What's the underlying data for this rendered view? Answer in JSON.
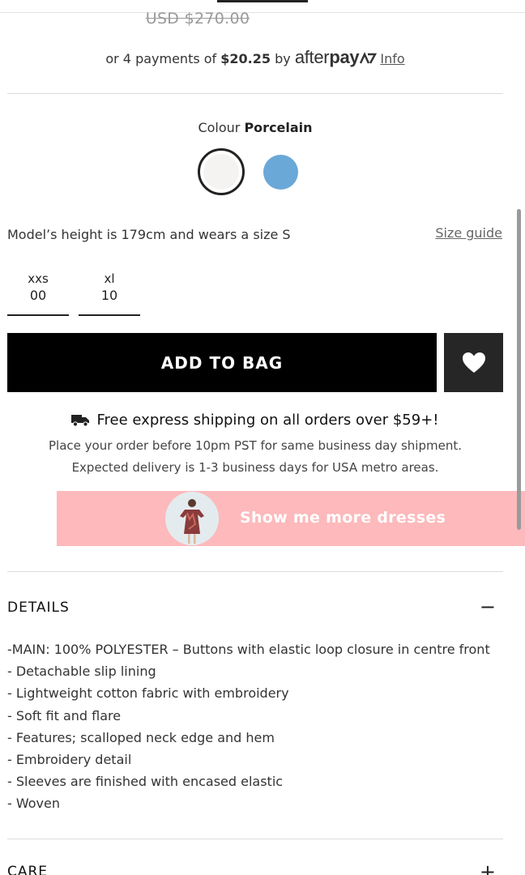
{
  "price": {
    "old_price": "USD $270.00"
  },
  "afterpay": {
    "prefix": "or 4 payments of ",
    "amount": "$20.25",
    "by": " by ",
    "logo_text_light": "after",
    "logo_text_bold": "pay",
    "info_label": "Info"
  },
  "colour": {
    "label": "Colour",
    "selected": "Porcelain",
    "swatches": [
      {
        "name": "Porcelain",
        "color": "#f4f3f1",
        "selected": true
      },
      {
        "name": "Blue",
        "color": "#6aa8d8",
        "selected": false
      }
    ]
  },
  "fit": {
    "model_text": "Model’s height is 179cm and wears a size S",
    "size_guide_label": "Size guide"
  },
  "sizes": [
    {
      "label": "xxs",
      "value": "00"
    },
    {
      "label": "xl",
      "value": "10"
    }
  ],
  "actions": {
    "add_to_bag_label": "ADD TO BAG",
    "wishlist_icon": "heart-icon"
  },
  "shipping": {
    "title": "Free express shipping on all orders over $59+!",
    "line1": "Place your order before 10pm PST for same business day shipment.",
    "line2": "Expected delivery is 1-3 business days for USA metro areas."
  },
  "promo": {
    "label": "Show me more dresses",
    "background": "#fdb9bb"
  },
  "details": {
    "title": "DETAILS",
    "toggle": "−",
    "items": [
      "-MAIN: 100% POLYESTER – Buttons with elastic loop closure in centre front",
      "- Detachable slip lining",
      "- Lightweight cotton fabric with embroidery",
      "- Soft fit and flare",
      "- Features; scalloped neck edge and hem",
      "- Embroidery detail",
      "- Sleeves are finished with encased elastic",
      "- Woven"
    ]
  },
  "care": {
    "title": "CARE",
    "toggle": "+"
  }
}
